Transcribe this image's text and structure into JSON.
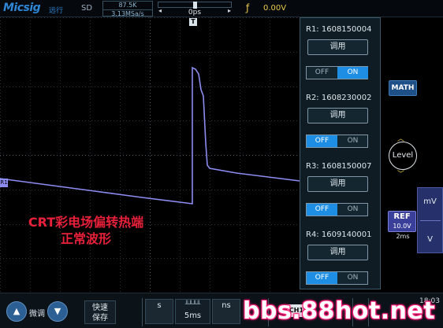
{
  "header": {
    "logo": "Micsig",
    "logo_cn": "远行",
    "acq_mode": "SD",
    "memory_depth": "87.5K",
    "sample_rate": "3.13MSa/s",
    "trigger_position": "0ps",
    "trigger_edge_icon": "rising-edge-icon",
    "trigger_level": "0.00V"
  },
  "screen": {
    "trigger_marker": "T",
    "channel_marker": "R1",
    "waveform_color": "#8d8cf2",
    "annotation_line1": "CRT彩电场偏转热端",
    "annotation_line2": "正常波形"
  },
  "ref_panel": {
    "call_label": "调用",
    "off_label": "OFF",
    "on_label": "ON",
    "refs": [
      {
        "title": "R1: 1608150004",
        "state": "ON"
      },
      {
        "title": "R2: 1608230002",
        "state": "OFF"
      },
      {
        "title": "R3: 1608150007",
        "state": "OFF"
      },
      {
        "title": "R4: 1609140001",
        "state": "OFF"
      }
    ]
  },
  "side": {
    "math_label": "MATH",
    "level_label": "Level",
    "ref_name": "REF",
    "ref_volts": "10.0V",
    "ref_time": "2ms",
    "unit_mv": "mV",
    "unit_v": "V"
  },
  "toolbar": {
    "fine_label": "微调",
    "quick_save_line1": "快速",
    "quick_save_line2": "保存",
    "unit_s": "s",
    "timebase_value": "5ms",
    "unit_ns": "ns",
    "ch_label": "CH1",
    "clock": "18:03"
  },
  "watermark": "bbs.88hot.net",
  "accent_colors": {
    "brand_blue": "#2e86d6",
    "trigger_yellow": "#e9c94a",
    "toggle_active": "#1d8ee3",
    "annotation_red": "#e8203a"
  }
}
